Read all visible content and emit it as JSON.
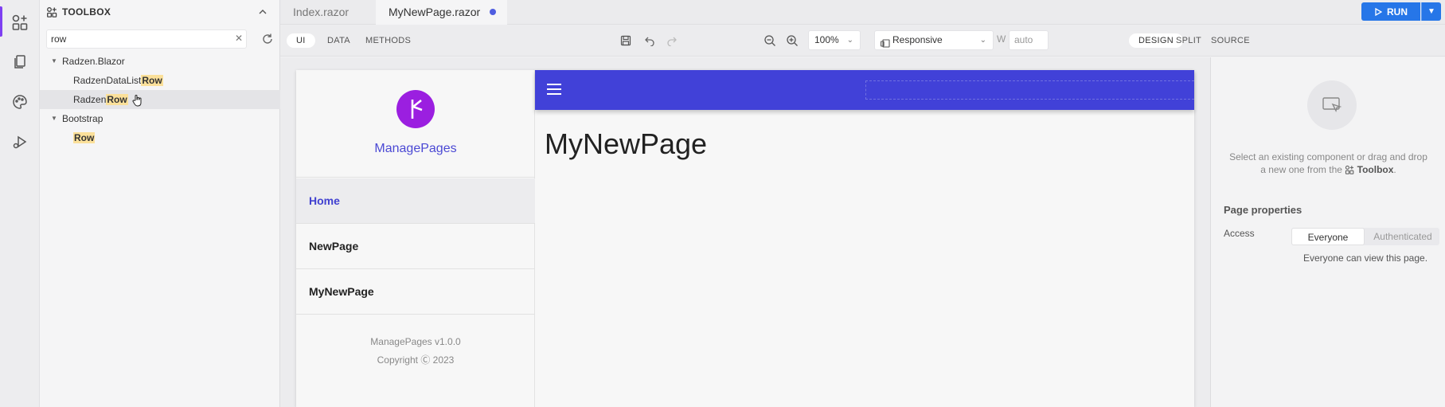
{
  "toolbox": {
    "title": "TOOLBOX",
    "search_value": "row",
    "groups": [
      {
        "name": "Radzen.Blazor",
        "items": [
          {
            "prefix": "RadzenDataList",
            "match": "Row"
          },
          {
            "prefix": "Radzen",
            "match": "Row"
          }
        ]
      },
      {
        "name": "Bootstrap",
        "items": [
          {
            "prefix": "",
            "match": "Row"
          }
        ]
      }
    ]
  },
  "tabs": [
    {
      "label": "Index.razor"
    },
    {
      "label": "MyNewPage.razor"
    }
  ],
  "run": {
    "label": "RUN"
  },
  "toolbar": {
    "modes": [
      "UI",
      "DATA",
      "METHODS"
    ],
    "zoom": "100%",
    "device": "Responsive",
    "width_label": "W",
    "width_placeholder": "auto",
    "views": [
      "DESIGN",
      "SPLIT",
      "SOURCE"
    ]
  },
  "preview": {
    "brand": "ManagePages",
    "nav": [
      "Home",
      "NewPage",
      "MyNewPage"
    ],
    "footer_version": "ManagePages v1.0.0",
    "footer_copyright": "Copyright Ⓒ 2023",
    "page_title": "MyNewPage",
    "header_color": "#4141d8",
    "logo_color": "#9b1fe0"
  },
  "properties": {
    "hint_pre": "Select an existing component or drag and drop a new one from the",
    "hint_link": "Toolbox",
    "hint_post": ".",
    "section_title": "Page properties",
    "access_label": "Access",
    "access_options": [
      "Everyone",
      "Authenticated"
    ],
    "access_selected": "Everyone",
    "access_note": "Everyone can view this page."
  },
  "colors": {
    "accent": "#7e3ff2",
    "run": "#2676e8",
    "highlight": "#fbe09a",
    "unsaved_dot": "#4f5de0"
  }
}
